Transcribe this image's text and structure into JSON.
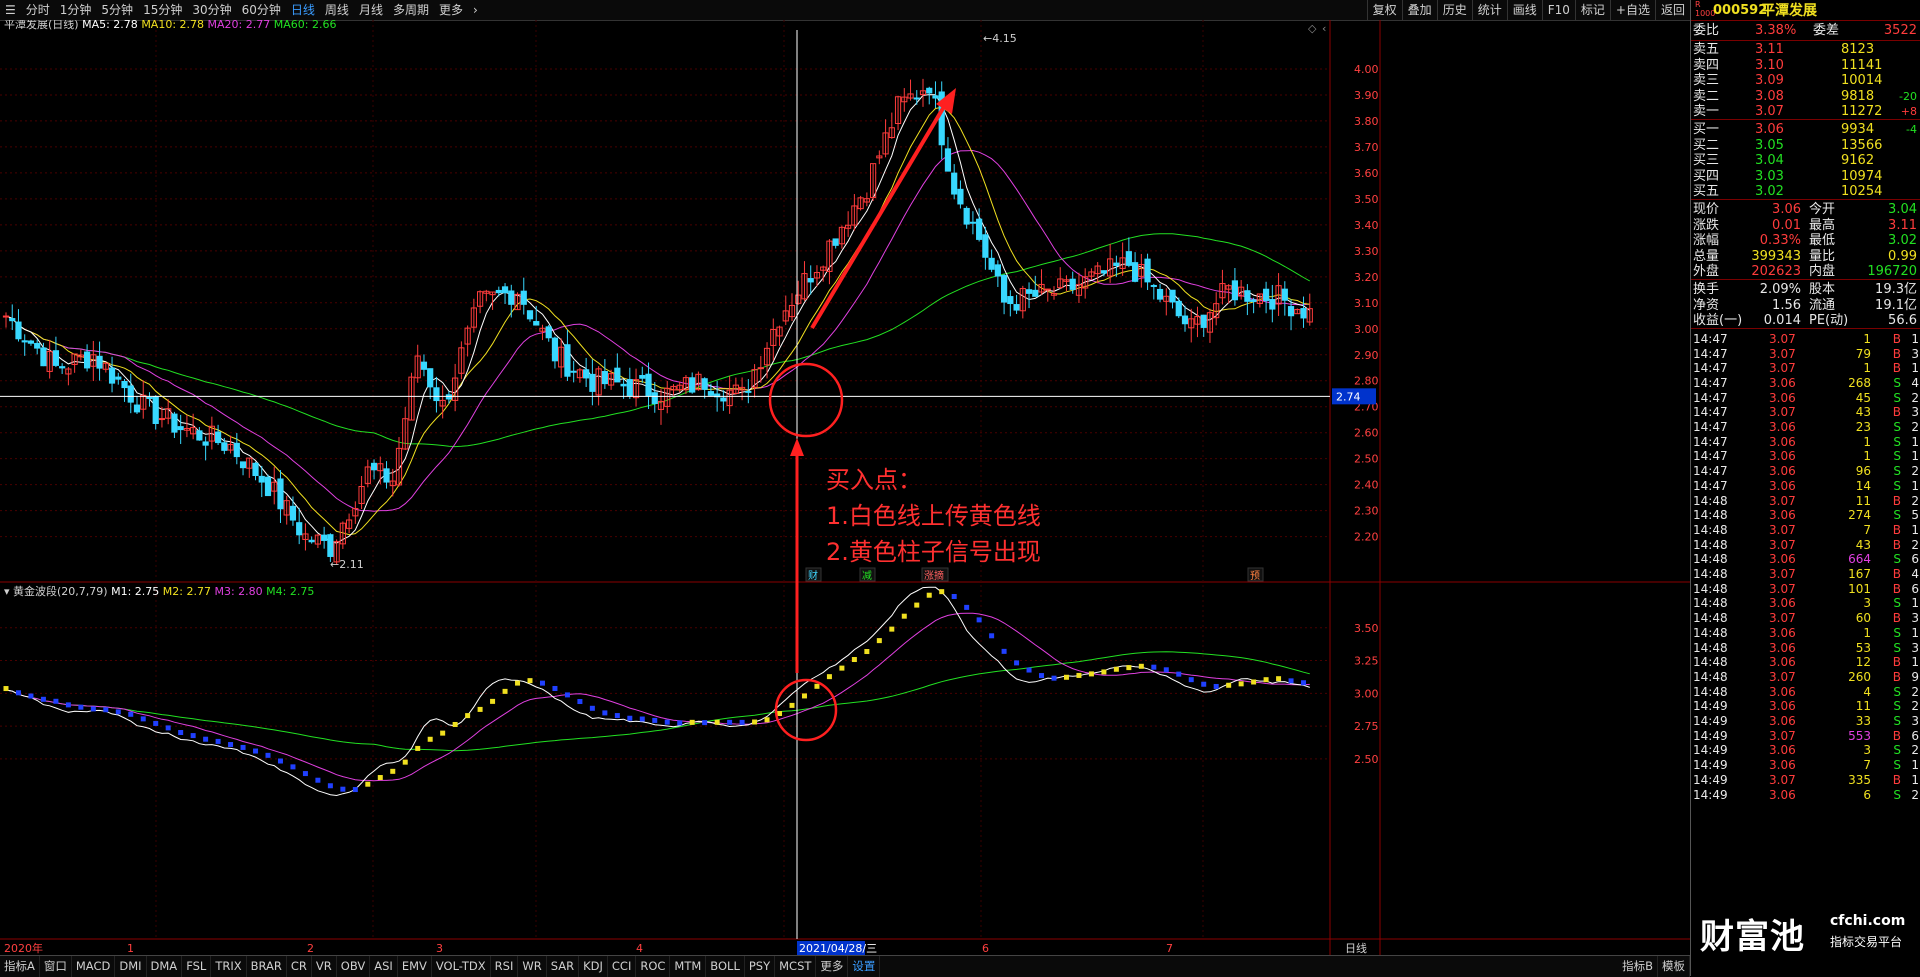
{
  "toolbar": {
    "periods": [
      "分时",
      "1分钟",
      "5分钟",
      "15分钟",
      "30分钟",
      "60分钟",
      "日线",
      "周线",
      "月线",
      "多周期",
      "更多"
    ],
    "active_period": "日线",
    "right_buttons": [
      "复权",
      "叠加",
      "历史",
      "统计",
      "画线",
      "F10",
      "标记",
      "+自选",
      "返回"
    ]
  },
  "main_chart": {
    "stock_label": "平潭发展(日线)",
    "ma": [
      {
        "label": "MA5: 2.78",
        "color": "#ffffff"
      },
      {
        "label": "MA10: 2.78",
        "color": "#f0e020"
      },
      {
        "label": "MA20: 2.77",
        "color": "#e040e0"
      },
      {
        "label": "MA60: 2.66",
        "color": "#22e022"
      }
    ],
    "y_ticks": [
      "4.00",
      "3.90",
      "3.80",
      "3.70",
      "3.60",
      "3.50",
      "3.40",
      "3.30",
      "3.20",
      "3.10",
      "3.00",
      "2.90",
      "2.80",
      "2.70",
      "2.60",
      "2.50",
      "2.40",
      "2.30",
      "2.20"
    ],
    "high_label": "4.15",
    "low_label": "2.11",
    "cursor_price": "2.74",
    "annotation_lines": [
      "买入点：",
      "1.白色线上传黄色线",
      "2.黄色柱子信号出现"
    ],
    "event_tags": [
      {
        "text": "财",
        "color": "#3fd6ff"
      },
      {
        "text": "减",
        "color": "#22e022"
      },
      {
        "text": "涨摘",
        "color": "#ff6060"
      },
      {
        "text": "预",
        "color": "#ff8040"
      }
    ]
  },
  "indicator": {
    "label": "黄金波段(20,7,79)",
    "values": [
      {
        "label": "M1: 2.75",
        "color": "#ffffff"
      },
      {
        "label": "M2: 2.77",
        "color": "#f0e020"
      },
      {
        "label": "M3: 2.80",
        "color": "#e040e0"
      },
      {
        "label": "M4: 2.75",
        "color": "#22e022"
      }
    ],
    "y_ticks": [
      "3.50",
      "3.25",
      "3.00",
      "2.75",
      "2.50"
    ]
  },
  "date_axis": {
    "labels": [
      "2020年",
      "1",
      "2",
      "3",
      "4",
      "2021/04/28/三",
      "6",
      "7"
    ],
    "period_label": "日线"
  },
  "bottombar": {
    "tabs": [
      "指标A",
      "窗口",
      "MACD",
      "DMI",
      "DMA",
      "FSL",
      "TRIX",
      "BRAR",
      "CR",
      "VR",
      "OBV",
      "ASI",
      "EMV",
      "VOL-TDX",
      "RSI",
      "WR",
      "SAR",
      "KDJ",
      "CCI",
      "ROC",
      "MTM",
      "BOLL",
      "PSY",
      "MCST",
      "更多",
      "设置"
    ],
    "active": "设置",
    "right_tabs": [
      "指标B",
      "模板"
    ]
  },
  "quote_panel": {
    "badge": "R\n1000",
    "code": "000592",
    "name": "平潭发展",
    "weibi": {
      "label": "委比",
      "value": "3.38%",
      "diff_label": "委差",
      "diff": "3522"
    },
    "asks": [
      {
        "label": "卖五",
        "price": "3.11",
        "vol": "8123",
        "chg": ""
      },
      {
        "label": "卖四",
        "price": "3.10",
        "vol": "11141",
        "chg": ""
      },
      {
        "label": "卖三",
        "price": "3.09",
        "vol": "10014",
        "chg": ""
      },
      {
        "label": "卖二",
        "price": "3.08",
        "vol": "9818",
        "chg": "-20"
      },
      {
        "label": "卖一",
        "price": "3.07",
        "vol": "11272",
        "chg": "+8"
      }
    ],
    "bids": [
      {
        "label": "买一",
        "price": "3.06",
        "vol": "9934",
        "chg": "-4"
      },
      {
        "label": "买二",
        "price": "3.05",
        "vol": "13566",
        "chg": ""
      },
      {
        "label": "买三",
        "price": "3.04",
        "vol": "9162",
        "chg": ""
      },
      {
        "label": "买四",
        "price": "3.03",
        "vol": "10974",
        "chg": ""
      },
      {
        "label": "买五",
        "price": "3.02",
        "vol": "10254",
        "chg": ""
      }
    ],
    "stats": [
      {
        "l1": "现价",
        "v1": "3.06",
        "c1": "red",
        "l2": "今开",
        "v2": "3.04",
        "c2": "green"
      },
      {
        "l1": "涨跌",
        "v1": "0.01",
        "c1": "red",
        "l2": "最高",
        "v2": "3.11",
        "c2": "red"
      },
      {
        "l1": "涨幅",
        "v1": "0.33%",
        "c1": "red",
        "l2": "最低",
        "v2": "3.02",
        "c2": "green"
      },
      {
        "l1": "总量",
        "v1": "399343",
        "c1": "yellow",
        "l2": "量比",
        "v2": "0.99",
        "c2": "yellow"
      },
      {
        "l1": "外盘",
        "v1": "202623",
        "c1": "red",
        "l2": "内盘",
        "v2": "196720",
        "c2": "green"
      }
    ],
    "stats2": [
      {
        "l1": "换手",
        "v1": "2.09%",
        "l2": "股本",
        "v2": "19.3亿"
      },
      {
        "l1": "净资",
        "v1": "1.56",
        "l2": "流通",
        "v2": "19.1亿"
      },
      {
        "l1": "收益(一)",
        "v1": "0.014",
        "l2": "PE(动)",
        "v2": "56.6"
      }
    ],
    "ticks": [
      [
        "14:47",
        "3.07",
        "1",
        "B",
        "1"
      ],
      [
        "14:47",
        "3.07",
        "79",
        "B",
        "3"
      ],
      [
        "14:47",
        "3.07",
        "1",
        "B",
        "1"
      ],
      [
        "14:47",
        "3.06",
        "268",
        "S",
        "4"
      ],
      [
        "14:47",
        "3.06",
        "45",
        "S",
        "2"
      ],
      [
        "14:47",
        "3.07",
        "43",
        "B",
        "3"
      ],
      [
        "14:47",
        "3.06",
        "23",
        "S",
        "2"
      ],
      [
        "14:47",
        "3.06",
        "1",
        "S",
        "1"
      ],
      [
        "14:47",
        "3.06",
        "1",
        "S",
        "1"
      ],
      [
        "14:47",
        "3.06",
        "96",
        "S",
        "2"
      ],
      [
        "14:47",
        "3.06",
        "14",
        "S",
        "1"
      ],
      [
        "14:48",
        "3.07",
        "11",
        "B",
        "2"
      ],
      [
        "14:48",
        "3.06",
        "274",
        "S",
        "5"
      ],
      [
        "14:48",
        "3.07",
        "7",
        "B",
        "1"
      ],
      [
        "14:48",
        "3.07",
        "43",
        "B",
        "2"
      ],
      [
        "14:48",
        "3.06",
        "664",
        "S",
        "6"
      ],
      [
        "14:48",
        "3.07",
        "167",
        "B",
        "4"
      ],
      [
        "14:48",
        "3.07",
        "101",
        "B",
        "6"
      ],
      [
        "14:48",
        "3.06",
        "3",
        "S",
        "1"
      ],
      [
        "14:48",
        "3.07",
        "60",
        "B",
        "3"
      ],
      [
        "14:48",
        "3.06",
        "1",
        "S",
        "1"
      ],
      [
        "14:48",
        "3.06",
        "53",
        "S",
        "3"
      ],
      [
        "14:48",
        "3.06",
        "12",
        "B",
        "1"
      ],
      [
        "14:48",
        "3.07",
        "260",
        "B",
        "9"
      ],
      [
        "14:48",
        "3.06",
        "4",
        "S",
        "2"
      ],
      [
        "14:49",
        "3.06",
        "11",
        "S",
        "2"
      ],
      [
        "14:49",
        "3.06",
        "33",
        "S",
        "3"
      ],
      [
        "14:49",
        "3.07",
        "553",
        "B",
        "6"
      ],
      [
        "14:49",
        "3.06",
        "3",
        "S",
        "2"
      ],
      [
        "14:49",
        "3.06",
        "7",
        "S",
        "1"
      ],
      [
        "14:49",
        "3.07",
        "335",
        "B",
        "1"
      ],
      [
        "14:49",
        "3.06",
        "6",
        "S",
        "2"
      ]
    ]
  },
  "watermark": {
    "brand": "财富池",
    "site": "cfchi.com",
    "tagline": "指标交易平台"
  },
  "chart_data": {
    "type": "candlestick",
    "price_range": [
      2.11,
      4.15
    ],
    "markers": {
      "high": 4.15,
      "low": 2.11,
      "cursor_date": "2021/04/28/三",
      "cursor_price": 2.74
    },
    "indicator_range": [
      2.4,
      3.75
    ]
  }
}
